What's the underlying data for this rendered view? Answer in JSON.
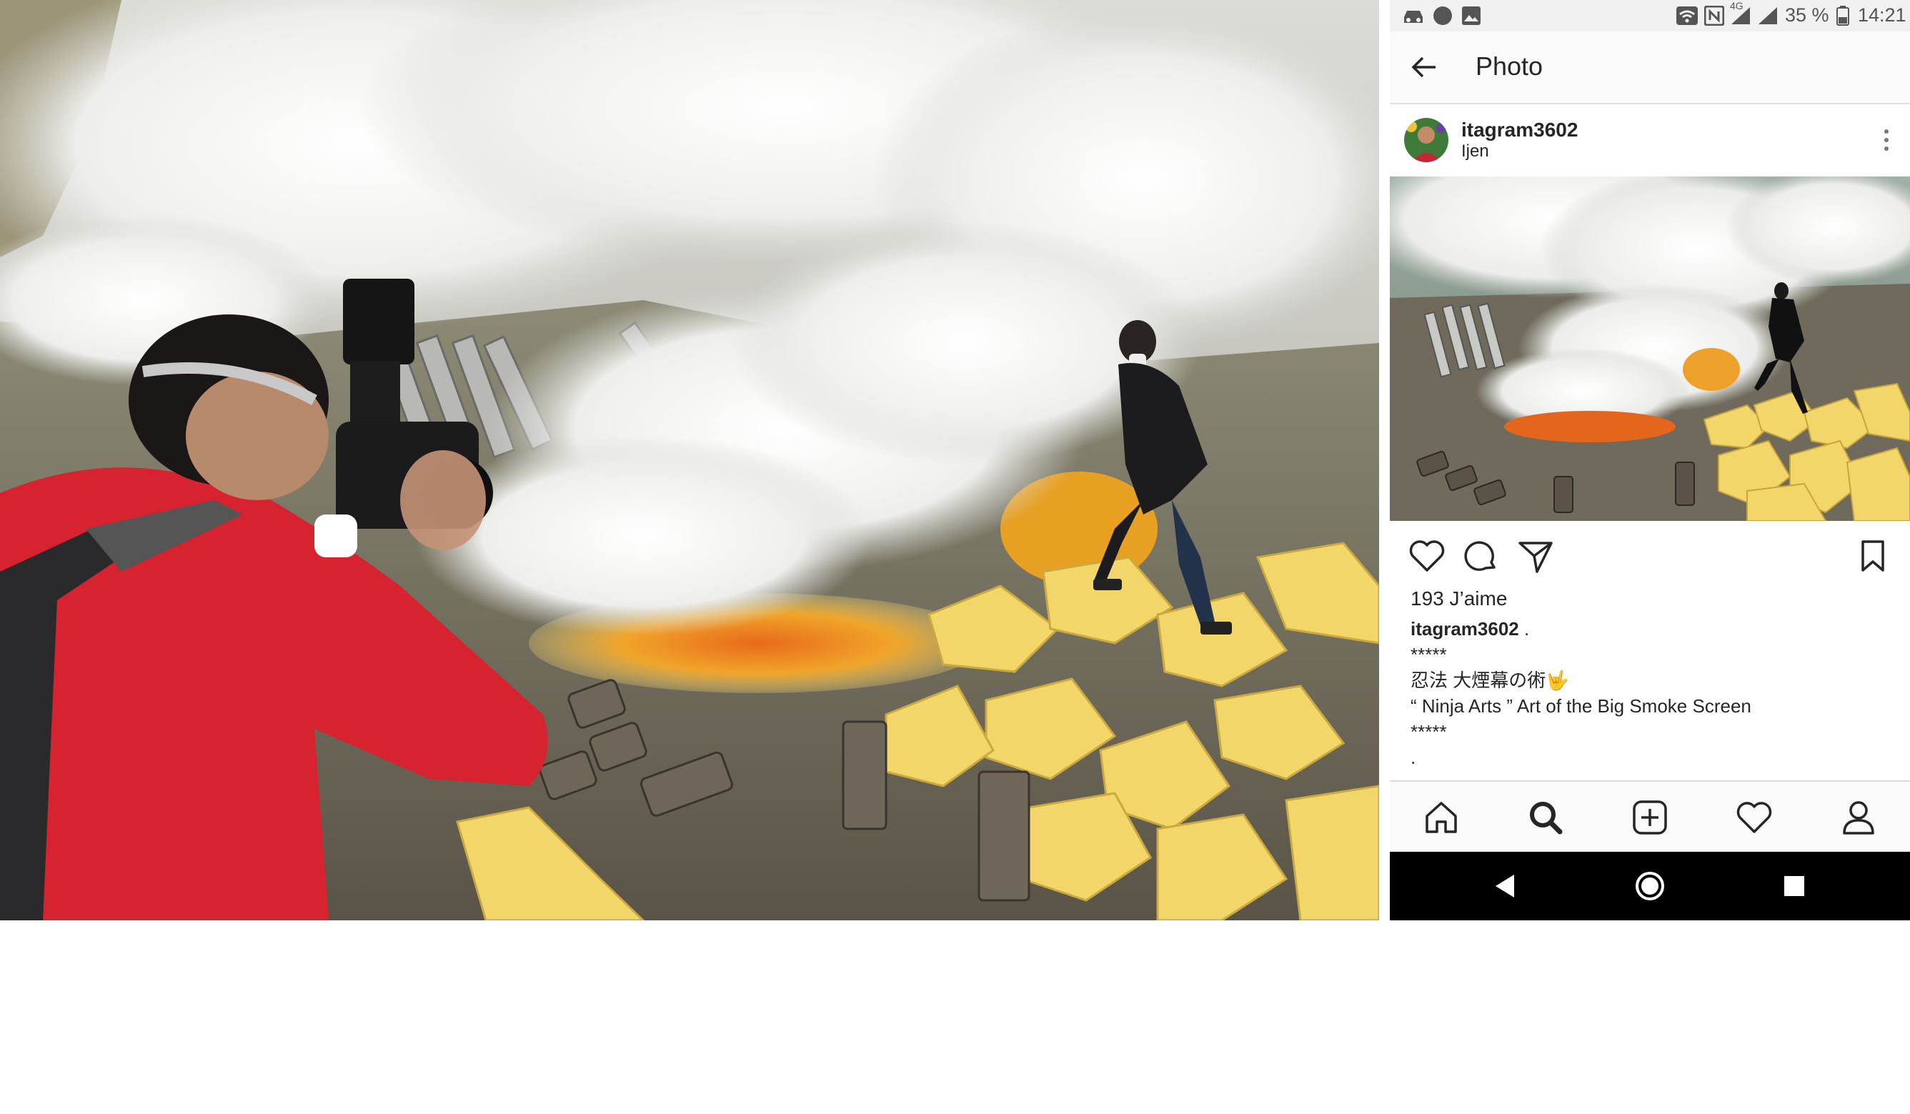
{
  "statusbar": {
    "battery": "35 %",
    "time": "14:21",
    "network": "4G",
    "icons": [
      "car-icon",
      "circle-icon",
      "image-icon",
      "wifi-icon",
      "nfc-icon",
      "signal-icon",
      "signal-icon",
      "battery-icon"
    ]
  },
  "appbar": {
    "title": "Photo",
    "back_icon": "back-arrow-icon"
  },
  "post": {
    "username": "itagram3602",
    "location": "Ijen",
    "likes": "193 J’aime",
    "caption": {
      "user": "itagram3602",
      "after_user": " .",
      "line1": "*****",
      "line2": "忍法 大煙幕の術🤟",
      "line3": "“ Ninja Arts ” Art of the Big Smoke Screen",
      "line4": "*****",
      "line5": "."
    }
  },
  "colors": {
    "jacket_red": "#d7232f",
    "sulfur_yellow": "#f2d66a",
    "lava_orange": "#e58a1a",
    "smoke": "#e9e9e6",
    "text": "#262626"
  },
  "actions": [
    "heart-icon",
    "comment-icon",
    "share-icon",
    "bookmark-icon"
  ],
  "bottom_nav": [
    "home-icon",
    "search-icon",
    "add-icon",
    "activity-heart-icon",
    "profile-icon"
  ],
  "system_nav": [
    "back-triangle-icon",
    "home-circle-icon",
    "recents-square-icon"
  ]
}
